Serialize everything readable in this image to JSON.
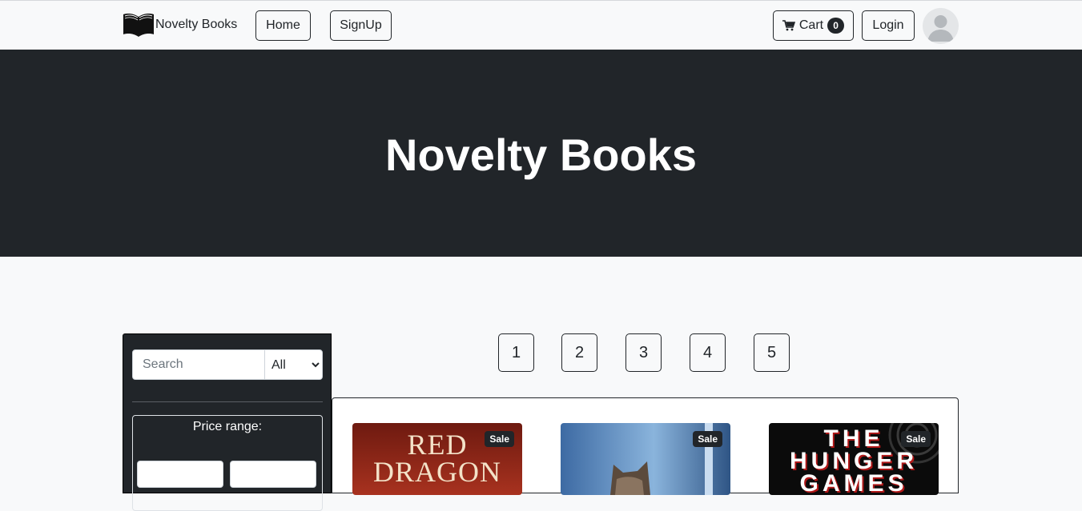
{
  "navbar": {
    "brand": "Novelty Books",
    "home_label": "Home",
    "signup_label": "SignUp",
    "cart_label": "Cart",
    "cart_count": "0",
    "login_label": "Login"
  },
  "hero": {
    "title": "Novelty Books"
  },
  "sidebar": {
    "search_placeholder": "Search",
    "category_selected": "All",
    "price_range_label": "Price range:"
  },
  "pagination": [
    "1",
    "2",
    "3",
    "4",
    "5"
  ],
  "products": [
    {
      "badge": "Sale",
      "cover_text": "RED DRAGON",
      "cover_color": "#7a1d12"
    },
    {
      "badge": "Sale",
      "cover_color": "#4a78b0"
    },
    {
      "badge": "Sale",
      "cover_text": "THE HUNGER GAMES",
      "cover_color": "#0b0b0b"
    }
  ],
  "colors": {
    "dark": "#212529",
    "light_bg": "#f8f9fa"
  }
}
